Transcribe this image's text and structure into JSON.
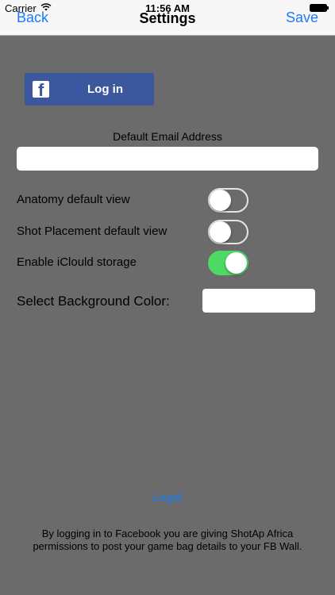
{
  "status_bar": {
    "carrier": "Carrier",
    "time": "11:56 AM"
  },
  "nav": {
    "title": "Settings",
    "back_label": "Back",
    "save_label": "Save"
  },
  "facebook": {
    "login_label": "Log in",
    "logo_glyph": "f",
    "color": "#3b579d"
  },
  "email": {
    "label": "Default Email Address",
    "value": "",
    "placeholder": ""
  },
  "toggles": [
    {
      "label": "Anatomy default view",
      "on": false
    },
    {
      "label": "Shot Placement default view",
      "on": false
    },
    {
      "label": "Enable iClould storage",
      "on": true
    }
  ],
  "background_color": {
    "label": "Select Background Color:",
    "value": "#ffffff"
  },
  "footer": {
    "legal_label": "Legal",
    "disclaimer": "By logging in to Facebook you are giving ShotAp Africa permissions to post your game bag details to your FB Wall."
  },
  "colors": {
    "accent": "#1a7cf6",
    "background": "#6b6b6b",
    "switch_on": "#4cd964"
  }
}
